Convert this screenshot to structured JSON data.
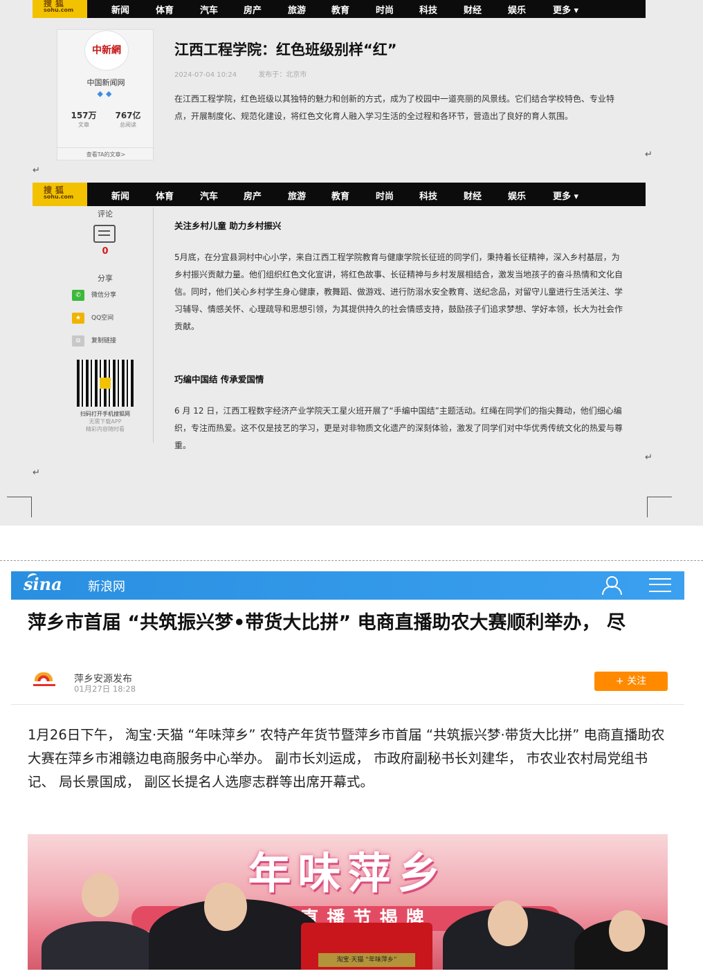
{
  "nav": {
    "logo_line1": "搜狐",
    "logo_line2": "sohu.com",
    "items": [
      "新闻",
      "体育",
      "汽车",
      "房产",
      "旅游",
      "教育",
      "时尚",
      "科技",
      "财经",
      "娱乐"
    ],
    "more": "更多 ▾"
  },
  "author": {
    "avatar_text": "中新網",
    "name": "中国新闻网",
    "badges": "◆◆",
    "articles_num": "157万",
    "articles_label": "文章",
    "reads_num": "767亿",
    "reads_label": "总阅读",
    "link": "查看TA的文章>"
  },
  "article": {
    "title": "江西工程学院：红色班级别样“红”",
    "date": "2024-07-04 10:24",
    "location": "发布于：北京市",
    "intro": "在江西工程学院，红色班级以其独特的魅力和创新的方式，成为了校园中一道亮丽的风景线。它们结合学校特色、专业特点，开展制度化、规范化建设，将红色文化育人融入学习生活的全过程和各环节，营造出了良好的育人氛围。",
    "section1_title": "关注乡村儿童 助力乡村振兴",
    "section1_body": "5月底，在分宜县洞村中心小学，来自江西工程学院教育与健康学院长征班的同学们，秉持着长征精神，深入乡村基层，为乡村振兴贡献力量。他们组织红色文化宣讲，将红色故事、长征精神与乡村发展相结合，激发当地孩子的奋斗热情和文化自信。同时，他们关心乡村学生身心健康，教舞蹈、做游戏、进行防溺水安全教育、送纪念品，对留守儿童进行生活关注、学习辅导、情感关怀、心理疏导和思想引领，为其提供持久的社会情感支持，鼓励孩子们追求梦想、学好本领，长大为社会作贡献。",
    "section2_title": "巧编中国结 传承爱国情",
    "section2_body": "6 月 12 日，江西工程数字经济产业学院天工星火班开展了“手编中国结”主题活动。红绳在同学们的指尖舞动，他们细心编织，专注而热爱。这不仅是技艺的学习，更是对非物质文化遗产的深刻体验，激发了同学们对中华优秀传统文化的热爱与尊重。"
  },
  "sidebar": {
    "comment_label": "评论",
    "comment_count": "0",
    "share_label": "分享",
    "share_items": [
      "微信分享",
      "QQ空间",
      "复制链接"
    ],
    "qr_caption": "扫码打开手机搜狐网",
    "qr_sub1": "无需下载APP",
    "qr_sub2": "精彩内容随时看"
  },
  "return_mark": "↵",
  "sina": {
    "logo": "sina",
    "site_name": "新浪网",
    "title": "萍乡市首届 “共筑振兴梦•带货大比拼” 电商直播助农大赛顺利举办， 尽",
    "source_name": "萍乡安源发布",
    "source_time": "01月27日 18:28",
    "follow": "+ 关注",
    "body": "1月26日下午， 淘宝·天猫 “年味萍乡” 农特产年货节暨萍乡市首届 “共筑振兴梦·带货大比拼” 电商直播助农大赛在萍乡市湘赣边电商服务中心举办。 副市长刘运成， 市政府副秘书长刘建华， 市农业农村局党组书记、 局长景国成， 副区长提名人选廖志群等出席开幕式。",
    "photo_title": "年味萍乡",
    "photo_banner": "文 直播节揭牌",
    "photo_plaque": "淘宝·天猫 “年味萍乡”"
  },
  "colors": {
    "sohu_yellow": "#f2c200",
    "sina_blue": "#2a8fe0",
    "follow_orange": "#ff8a00",
    "comment_red": "#d21a1a"
  }
}
